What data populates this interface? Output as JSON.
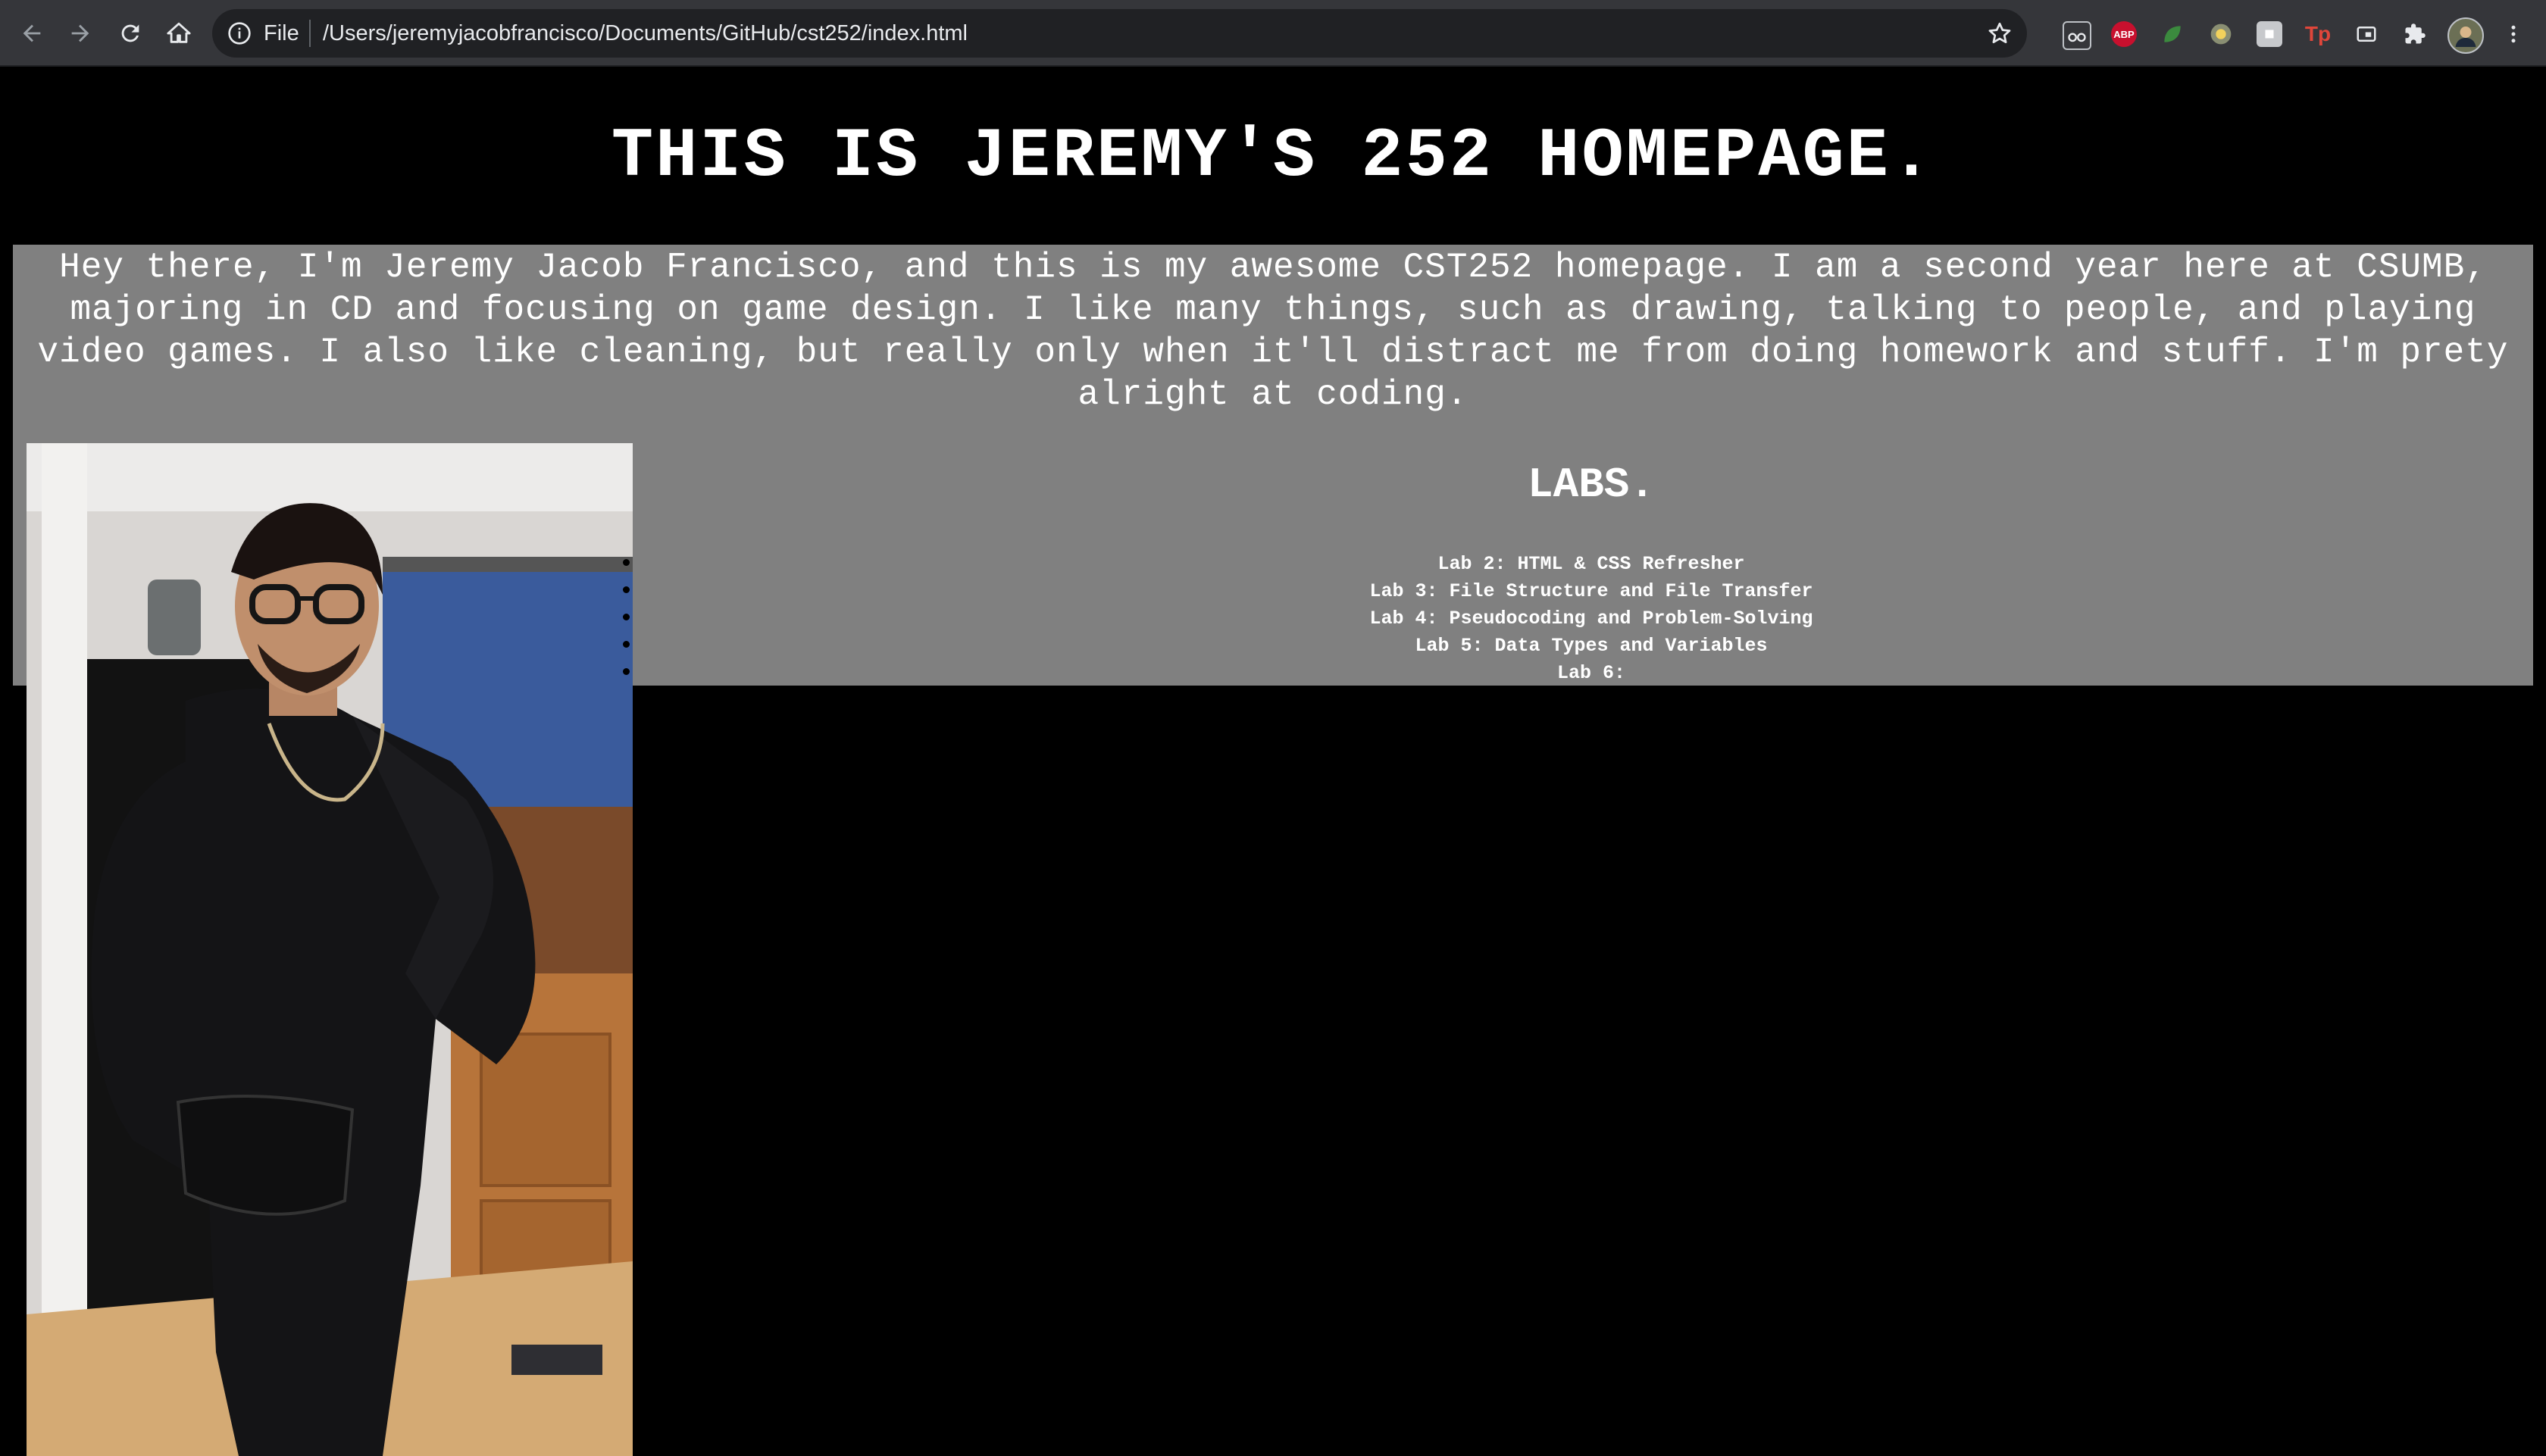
{
  "browser": {
    "scheme_label": "File",
    "url": "/Users/jeremyjacobfrancisco/Documents/GitHub/cst252/index.html",
    "nav_icons": [
      "back-arrow-icon",
      "forward-arrow-icon",
      "reload-icon",
      "home-icon"
    ],
    "extension_icons": [
      "reading-glasses-icon",
      "adblock-plus-icon",
      "green-leaf-icon",
      "yellow-circle-icon",
      "grey-puzzle-tile-icon",
      "tp-icon",
      "cast-icon",
      "extensions-puzzle-icon",
      "profile-avatar-icon",
      "menu-kebab-icon"
    ],
    "abp_label": "ABP",
    "tp_label": "Tp"
  },
  "page": {
    "title": "THIS IS JEREMY'S 252 HOMEPAGE.",
    "intro_lines": [
      "Hey there, I'm Jeremy Jacob Francisco, and this is my awesome CST252 homepage. I am a second year here at CSUMB,",
      "majoring in CD and focusing on game design. I like many things, such as drawing, talking to people, and playing",
      "video games. I also like cleaning, but really only when it'll distract me from doing homework and stuff. I'm prety",
      "alright at coding."
    ],
    "labs_heading": "LABS.",
    "labs": [
      "Lab 2: HTML & CSS Refresher",
      "Lab 3: File Structure and File Transfer",
      "Lab 4: Pseudocoding and Problem-Solving",
      "Lab 5: Data Types and Variables",
      "Lab 6:"
    ],
    "colors": {
      "background": "#000000",
      "content_box": "#808080",
      "text": "#ffffff",
      "chrome": "#35363a",
      "omnibox": "#202124"
    }
  }
}
